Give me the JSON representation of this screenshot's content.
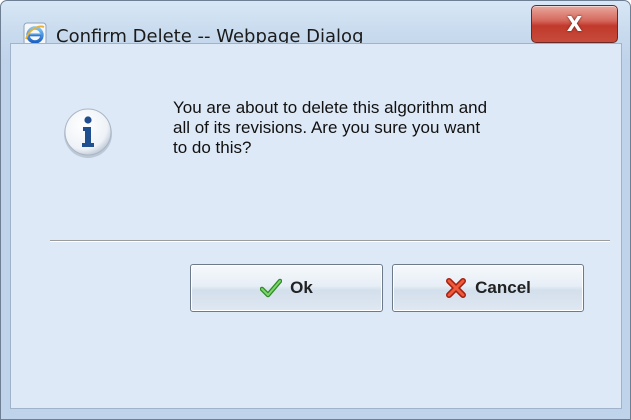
{
  "window": {
    "title": "Confirm Delete -- Webpage Dialog",
    "close_label": "X",
    "icon": "internet-explorer-icon"
  },
  "dialog": {
    "icon": "info-icon",
    "message": "You are about to delete this algorithm and all of its revisions. Are you sure you want to do this?",
    "message_lines": [
      "You are about to delete this algorithm and",
      "all of its revisions. Are you sure you want",
      "to do this?"
    ]
  },
  "buttons": {
    "ok": {
      "label": "Ok",
      "icon": "checkmark-icon",
      "icon_color": "#3ea335"
    },
    "cancel": {
      "label": "Cancel",
      "icon": "red-x-icon",
      "icon_color": "#d8381e"
    }
  },
  "colors": {
    "close_button": "#c84a3c",
    "client_background": "#dee9f7",
    "info_icon": "#1f4f8f"
  }
}
